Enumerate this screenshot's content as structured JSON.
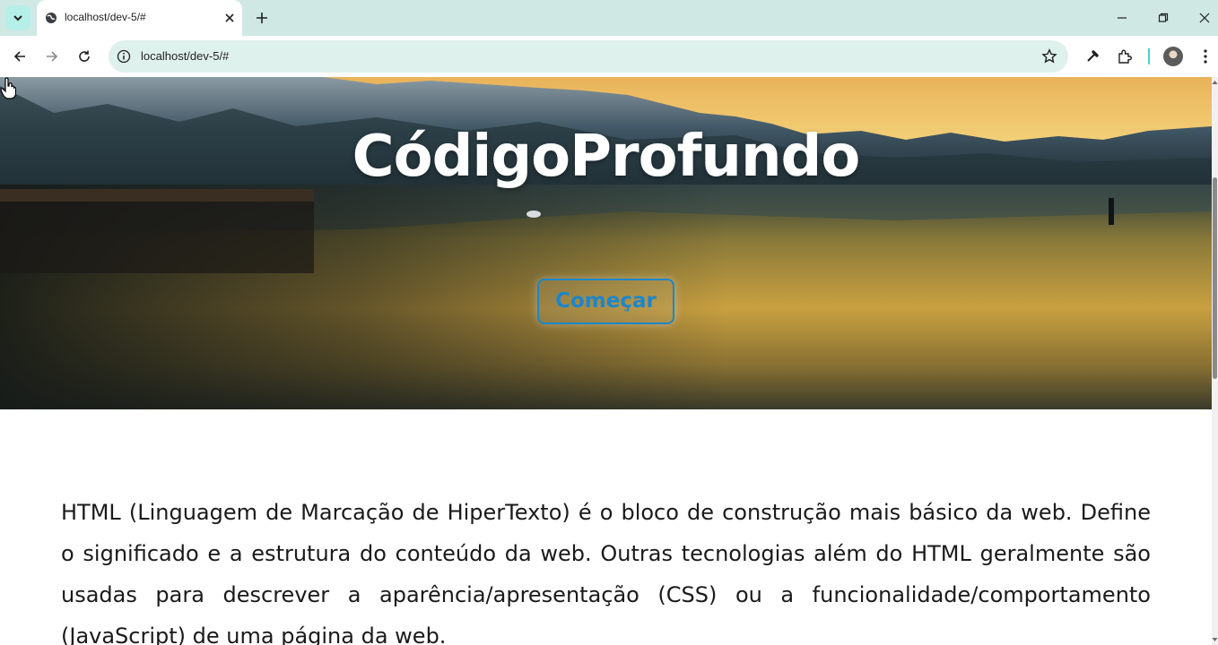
{
  "browser": {
    "tab": {
      "title": "localhost/dev-5/#"
    },
    "address_bar": {
      "url": "localhost/dev-5/#"
    },
    "colors": {
      "tabstrip": "#cfe8e4",
      "omnibox": "#dff1ec",
      "accent": "#4fd0c5"
    }
  },
  "page": {
    "hero": {
      "title": "CódigoProfundo",
      "cta_label": "Começar",
      "cta_color": "#1e86c8"
    },
    "content": {
      "paragraph": "HTML (Linguagem de Marcação de HiperTexto) é o bloco de construção mais básico da web. Define o significado e a estrutura do conteúdo da web. Outras tecnologias além do HTML geralmente são usadas para descrever a aparência/apresentação (CSS) ou a funcionalidade/comportamento (JavaScript) de uma página da web."
    }
  }
}
